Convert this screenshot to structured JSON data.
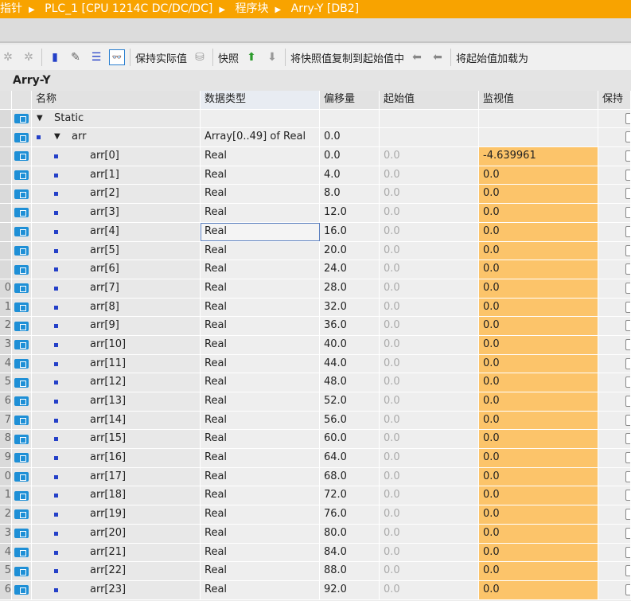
{
  "breadcrumb": [
    "指针",
    "PLC_1 [CPU 1214C DC/DC/DC]",
    "程序块",
    "Arry-Y [DB2]"
  ],
  "toolbar": {
    "keep_actual": "保持实际值",
    "snapshot": "快照",
    "copy_snapshot": "将快照值复制到起始值中",
    "load_start": "将起始值加载为"
  },
  "db_title": "Arry-Y",
  "columns": [
    "名称",
    "数据类型",
    "偏移量",
    "起始值",
    "监视值",
    "保持"
  ],
  "colors": {
    "title_bar": "#f8a300",
    "monitor_bg": "#fcc46a",
    "interface_icon": "#1e8fd6"
  },
  "rows": [
    {
      "rn": "",
      "name": "Static",
      "level": 0,
      "expand": true,
      "type": "",
      "offset": "",
      "start": "",
      "monitor": ""
    },
    {
      "rn": "",
      "name": "arr",
      "level": 1,
      "expand": true,
      "type": "Array[0..49] of Real",
      "offset": "0.0",
      "start": "",
      "monitor": ""
    },
    {
      "rn": "",
      "name": "arr[0]",
      "level": 2,
      "type": "Real",
      "offset": "0.0",
      "start": "0.0",
      "monitor": "-4.639961"
    },
    {
      "rn": "",
      "name": "arr[1]",
      "level": 2,
      "type": "Real",
      "offset": "4.0",
      "start": "0.0",
      "monitor": "0.0"
    },
    {
      "rn": "",
      "name": "arr[2]",
      "level": 2,
      "type": "Real",
      "offset": "8.0",
      "start": "0.0",
      "monitor": "0.0"
    },
    {
      "rn": "",
      "name": "arr[3]",
      "level": 2,
      "type": "Real",
      "offset": "12.0",
      "start": "0.0",
      "monitor": "0.0"
    },
    {
      "rn": "",
      "name": "arr[4]",
      "level": 2,
      "type": "Real",
      "offset": "16.0",
      "start": "0.0",
      "monitor": "0.0",
      "selected": true
    },
    {
      "rn": "",
      "name": "arr[5]",
      "level": 2,
      "type": "Real",
      "offset": "20.0",
      "start": "0.0",
      "monitor": "0.0"
    },
    {
      "rn": "",
      "name": "arr[6]",
      "level": 2,
      "type": "Real",
      "offset": "24.0",
      "start": "0.0",
      "monitor": "0.0"
    },
    {
      "rn": "0",
      "name": "arr[7]",
      "level": 2,
      "type": "Real",
      "offset": "28.0",
      "start": "0.0",
      "monitor": "0.0"
    },
    {
      "rn": "1",
      "name": "arr[8]",
      "level": 2,
      "type": "Real",
      "offset": "32.0",
      "start": "0.0",
      "monitor": "0.0"
    },
    {
      "rn": "2",
      "name": "arr[9]",
      "level": 2,
      "type": "Real",
      "offset": "36.0",
      "start": "0.0",
      "monitor": "0.0"
    },
    {
      "rn": "3",
      "name": "arr[10]",
      "level": 2,
      "type": "Real",
      "offset": "40.0",
      "start": "0.0",
      "monitor": "0.0"
    },
    {
      "rn": "4",
      "name": "arr[11]",
      "level": 2,
      "type": "Real",
      "offset": "44.0",
      "start": "0.0",
      "monitor": "0.0"
    },
    {
      "rn": "5",
      "name": "arr[12]",
      "level": 2,
      "type": "Real",
      "offset": "48.0",
      "start": "0.0",
      "monitor": "0.0"
    },
    {
      "rn": "6",
      "name": "arr[13]",
      "level": 2,
      "type": "Real",
      "offset": "52.0",
      "start": "0.0",
      "monitor": "0.0"
    },
    {
      "rn": "7",
      "name": "arr[14]",
      "level": 2,
      "type": "Real",
      "offset": "56.0",
      "start": "0.0",
      "monitor": "0.0"
    },
    {
      "rn": "8",
      "name": "arr[15]",
      "level": 2,
      "type": "Real",
      "offset": "60.0",
      "start": "0.0",
      "monitor": "0.0"
    },
    {
      "rn": "9",
      "name": "arr[16]",
      "level": 2,
      "type": "Real",
      "offset": "64.0",
      "start": "0.0",
      "monitor": "0.0"
    },
    {
      "rn": "0",
      "name": "arr[17]",
      "level": 2,
      "type": "Real",
      "offset": "68.0",
      "start": "0.0",
      "monitor": "0.0"
    },
    {
      "rn": "1",
      "name": "arr[18]",
      "level": 2,
      "type": "Real",
      "offset": "72.0",
      "start": "0.0",
      "monitor": "0.0"
    },
    {
      "rn": "2",
      "name": "arr[19]",
      "level": 2,
      "type": "Real",
      "offset": "76.0",
      "start": "0.0",
      "monitor": "0.0"
    },
    {
      "rn": "3",
      "name": "arr[20]",
      "level": 2,
      "type": "Real",
      "offset": "80.0",
      "start": "0.0",
      "monitor": "0.0"
    },
    {
      "rn": "4",
      "name": "arr[21]",
      "level": 2,
      "type": "Real",
      "offset": "84.0",
      "start": "0.0",
      "monitor": "0.0"
    },
    {
      "rn": "5",
      "name": "arr[22]",
      "level": 2,
      "type": "Real",
      "offset": "88.0",
      "start": "0.0",
      "monitor": "0.0"
    },
    {
      "rn": "6",
      "name": "arr[23]",
      "level": 2,
      "type": "Real",
      "offset": "92.0",
      "start": "0.0",
      "monitor": "0.0"
    }
  ]
}
